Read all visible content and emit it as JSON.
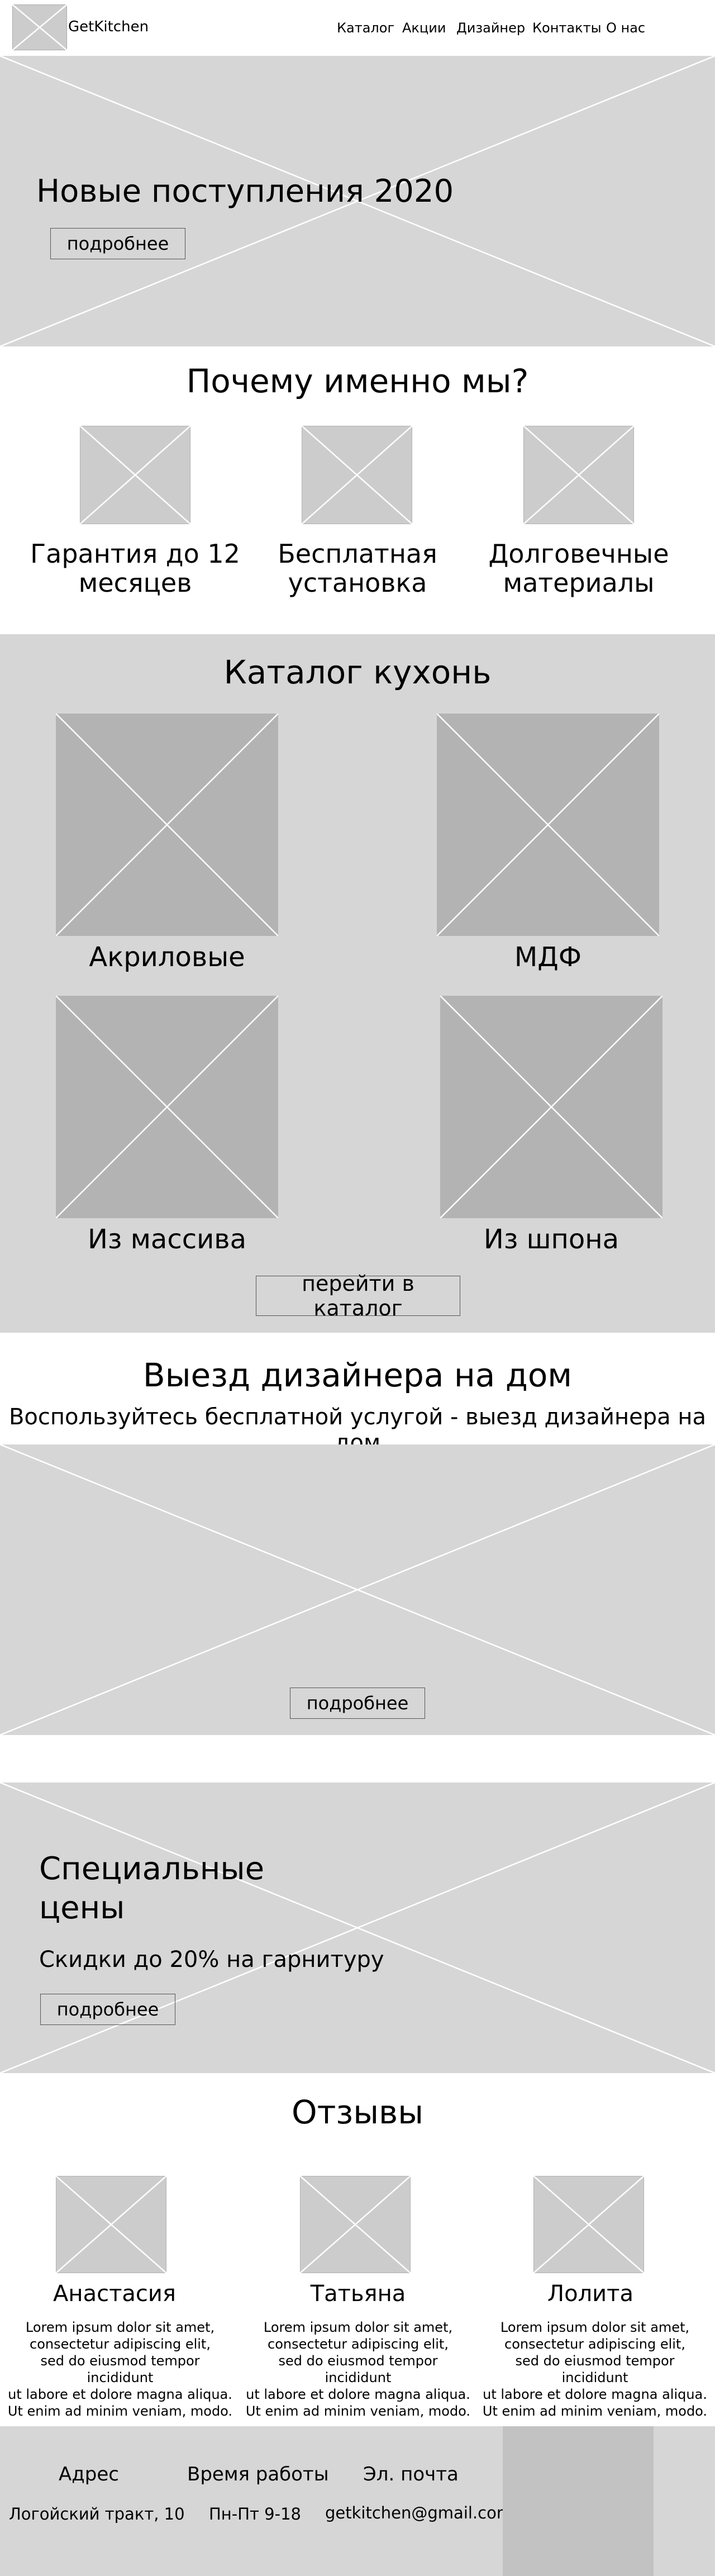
{
  "header": {
    "brand": "GetKitchen",
    "nav": [
      "Каталог",
      "Акции",
      "Дизайнер",
      "Контакты",
      "О нас"
    ]
  },
  "hero": {
    "title": "Новые поступления 2020",
    "button": "подробнее"
  },
  "why_us": {
    "title": "Почему именно мы?",
    "features": [
      {
        "line1": "Гарантия до 12",
        "line2": "месяцев"
      },
      {
        "line1": "Бесплатная",
        "line2": "установка"
      },
      {
        "line1": "Долговечные",
        "line2": "материалы"
      }
    ]
  },
  "catalog": {
    "title": "Каталог кухонь",
    "items": [
      "Акриловые",
      "МДФ",
      "Из массива",
      "Из шпона"
    ],
    "button": "перейти в каталог"
  },
  "designer": {
    "title": "Выезд дизайнера на дом",
    "subtitle": "Воспользуйтесь бесплатной услугой - выезд дизайнера на дом",
    "button": "подробнее"
  },
  "special": {
    "title_line1": "Специальные",
    "title_line2": "цены",
    "subtitle": "Скидки до 20% на гарнитуру",
    "button": "подробнее"
  },
  "reviews": {
    "title": "Отзывы",
    "items": [
      {
        "name": "Анастасия",
        "text": [
          "Lorem ipsum dolor sit amet,",
          "consectetur adipiscing elit,",
          "sed do eiusmod tempor incididunt",
          "ut labore et dolore magna aliqua.",
          "Ut enim ad minim veniam, modo."
        ]
      },
      {
        "name": "Татьяна",
        "text": [
          "Lorem ipsum dolor sit amet,",
          "consectetur adipiscing elit,",
          "sed do eiusmod tempor incididunt",
          "ut labore et dolore magna aliqua.",
          "Ut enim ad minim veniam, modo."
        ]
      },
      {
        "name": "Лолита",
        "text": [
          "Lorem ipsum dolor sit amet,",
          "consectetur adipiscing elit,",
          "sed do eiusmod tempor incididunt",
          "ut labore et dolore magna aliqua.",
          "Ut enim ad minim veniam, modo."
        ]
      }
    ]
  },
  "footer": {
    "address_label": "Адрес",
    "address": "Логойский тракт, 10",
    "hours_label": "Время работы",
    "hours": "Пн-Пт 9-18",
    "email_label": "Эл. почта",
    "email": "getkitchen@gmail.com"
  },
  "colors": {
    "band": "#d6d6d6",
    "placeholder_dark": "#b3b3b3",
    "placeholder_light": "#cccccc",
    "map_block": "#c2c2c2"
  }
}
